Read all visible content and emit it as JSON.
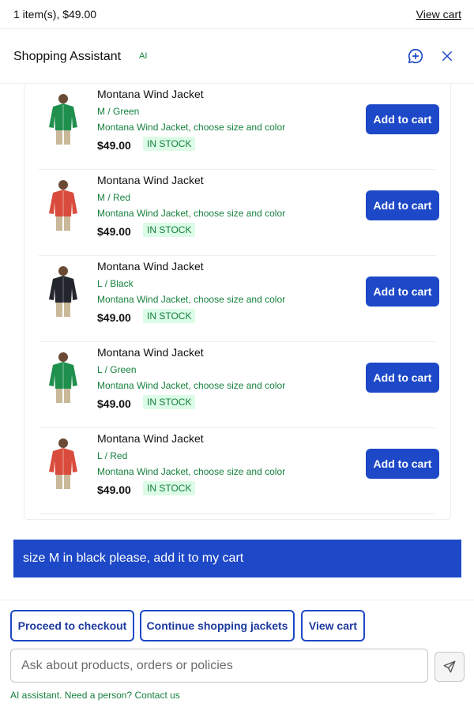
{
  "topbar": {
    "cart_summary": "1 item(s), $49.00",
    "view_cart_label": "View cart"
  },
  "header": {
    "title": "Shopping Assistant",
    "badge": "AI",
    "new_chat_icon": "chat-plus-icon",
    "close_icon": "close-icon"
  },
  "products": [
    {
      "name": "Montana Wind Jacket",
      "variant": "M / Green",
      "description": "Montana Wind Jacket, choose size and color",
      "price": "$49.00",
      "stock": "IN STOCK",
      "button": "Add to cart",
      "color": "#1f8f4e"
    },
    {
      "name": "Montana Wind Jacket",
      "variant": "M / Red",
      "description": "Montana Wind Jacket, choose size and color",
      "price": "$49.00",
      "stock": "IN STOCK",
      "button": "Add to cart",
      "color": "#d94c3d"
    },
    {
      "name": "Montana Wind Jacket",
      "variant": "L / Black",
      "description": "Montana Wind Jacket, choose size and color",
      "price": "$49.00",
      "stock": "IN STOCK",
      "button": "Add to cart",
      "color": "#24262e"
    },
    {
      "name": "Montana Wind Jacket",
      "variant": "L / Green",
      "description": "Montana Wind Jacket, choose size and color",
      "price": "$49.00",
      "stock": "IN STOCK",
      "button": "Add to cart",
      "color": "#1f8f4e"
    },
    {
      "name": "Montana Wind Jacket",
      "variant": "L / Red",
      "description": "Montana Wind Jacket, choose size and color",
      "price": "$49.00",
      "stock": "IN STOCK",
      "button": "Add to cart",
      "color": "#d94c3d"
    }
  ],
  "user_message": "size M in black please, add it to my cart",
  "quick_actions": [
    "Proceed to checkout",
    "Continue shopping jackets",
    "View cart"
  ],
  "input": {
    "placeholder": "Ask about products, orders or policies",
    "value": ""
  },
  "footer": {
    "text": "AI assistant. Need a person?",
    "link": "Contact us"
  },
  "colors": {
    "accent": "#1d48c7",
    "success": "#15803d",
    "success_bg": "#dcfce7"
  }
}
